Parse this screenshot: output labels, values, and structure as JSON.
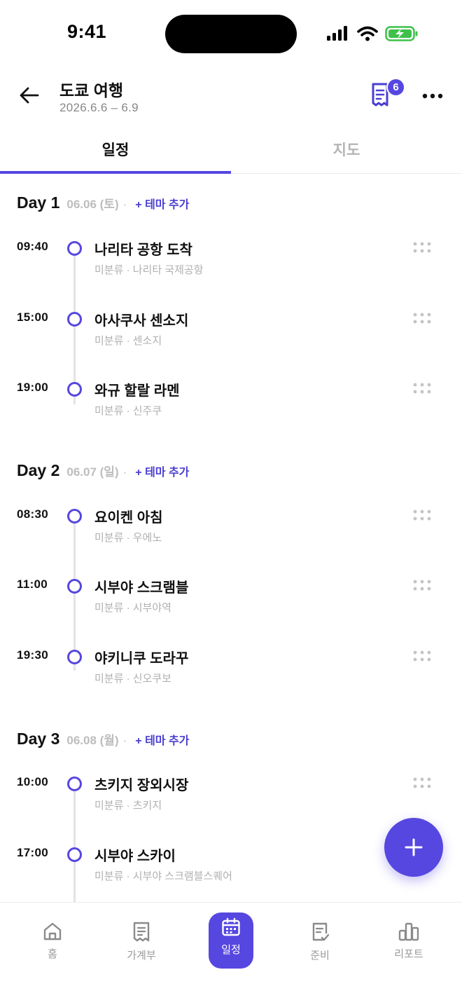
{
  "status_bar": {
    "time": "9:41"
  },
  "header": {
    "title": "도쿄 여행",
    "dates": "2026.6.6 – 6.9",
    "receipt_badge": "6"
  },
  "tabs": [
    {
      "label": "일정",
      "active": true
    },
    {
      "label": "지도",
      "active": false
    }
  ],
  "days": [
    {
      "label": "Day 1",
      "date": "06.06 (토)",
      "dot": "·",
      "add_theme": "+ 테마 추가",
      "events": [
        {
          "time": "09:40",
          "title": "나리타 공항 도착",
          "sub": "미분류 · 나리타 국제공항"
        },
        {
          "time": "15:00",
          "title": "아사쿠사 센소지",
          "sub": "미분류 · 센소지"
        },
        {
          "time": "19:00",
          "title": "와규 할랄 라멘",
          "sub": "미분류 · 신주쿠"
        }
      ]
    },
    {
      "label": "Day 2",
      "date": "06.07 (일)",
      "dot": "·",
      "add_theme": "+ 테마 추가",
      "events": [
        {
          "time": "08:30",
          "title": "요이켄 아침",
          "sub": "미분류 · 우에노"
        },
        {
          "time": "11:00",
          "title": "시부야 스크램블",
          "sub": "미분류 · 시부야역"
        },
        {
          "time": "19:30",
          "title": "야키니쿠 도라꾸",
          "sub": "미분류 · 신오쿠보"
        }
      ]
    },
    {
      "label": "Day 3",
      "date": "06.08 (월)",
      "dot": "·",
      "add_theme": "+ 테마 추가",
      "events": [
        {
          "time": "10:00",
          "title": "츠키지 장외시장",
          "sub": "미분류 · 츠키지"
        },
        {
          "time": "17:00",
          "title": "시부야 스카이",
          "sub": "미분류 · 시부야 스크램블스퀘어"
        }
      ]
    }
  ],
  "bottom_nav": [
    {
      "label": "홈",
      "icon": "home-icon",
      "active": false
    },
    {
      "label": "가계부",
      "icon": "receipt-icon",
      "active": false
    },
    {
      "label": "일정",
      "icon": "calendar-icon",
      "active": true
    },
    {
      "label": "준비",
      "icon": "checklist-icon",
      "active": false
    },
    {
      "label": "리포트",
      "icon": "bar-chart-icon",
      "active": false
    }
  ],
  "colors": {
    "accent": "#5647e0",
    "muted": "#b0b0b0",
    "text": "#111111"
  }
}
